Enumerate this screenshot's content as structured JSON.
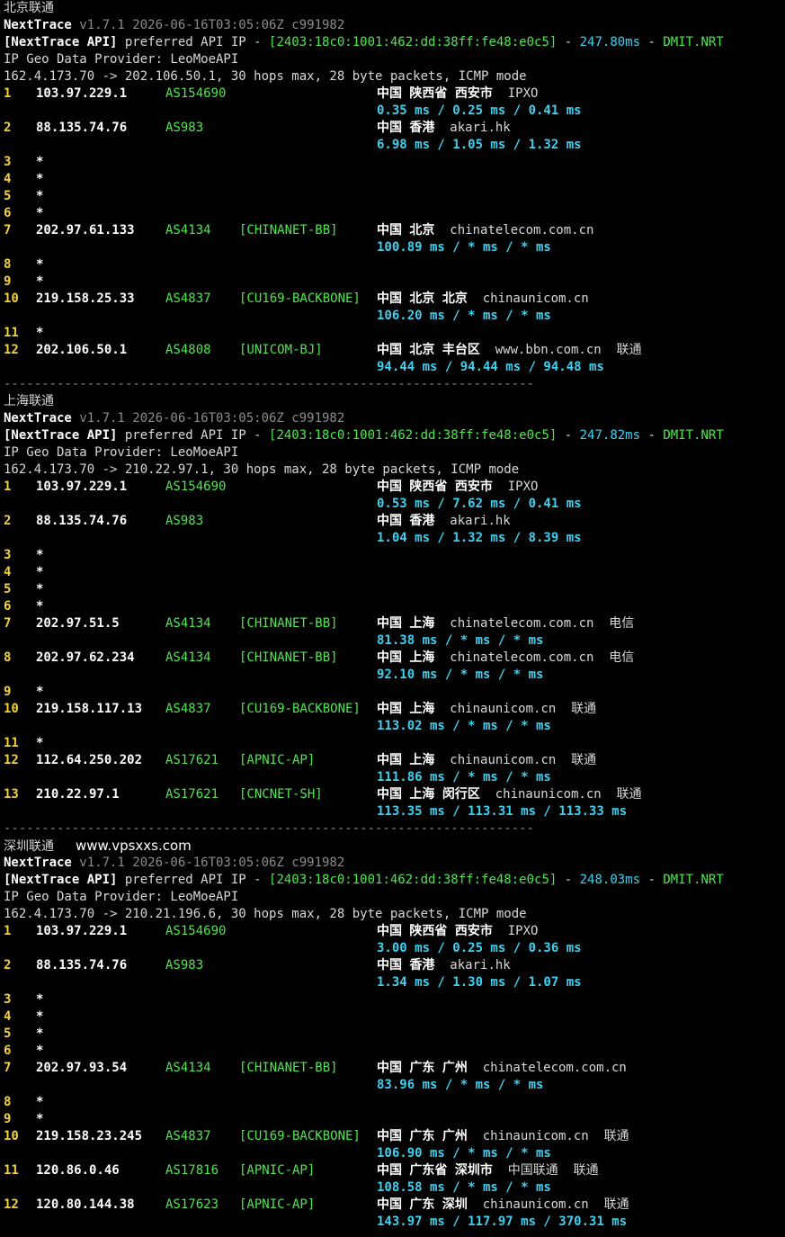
{
  "sections": [
    {
      "title": "北京联通",
      "watermark": "",
      "nexttrace_label": "NextTrace",
      "version": "v1.7.1 2026-06-16T03:05:06Z c991982",
      "api_label": "[NextTrace API]",
      "api_text": "preferred API IP - ",
      "api_ip": "[2403:18c0:1001:462:dd:38ff:fe48:e0c5]",
      "api_dash": " - ",
      "api_latency": "247.80ms",
      "api_dash2": " - ",
      "api_node": "DMIT.NRT",
      "geo_provider": "IP Geo Data Provider: LeoMoeAPI",
      "trace_header": "162.4.173.70 -> 202.106.50.1, 30 hops max, 28 byte packets, ICMP mode",
      "hops": [
        {
          "n": "1",
          "ip": "103.97.229.1",
          "as": "AS154690",
          "tag": "",
          "geo": "中国 陕西省 西安市",
          "host": "IPXO",
          "isp": "",
          "rtt": "0.35 ms / 0.25 ms / 0.41 ms"
        },
        {
          "n": "2",
          "ip": "88.135.74.76",
          "as": "AS983",
          "tag": "",
          "geo": "中国 香港",
          "host": "akari.hk",
          "isp": "",
          "rtt": "6.98 ms / 1.05 ms / 1.32 ms"
        },
        {
          "n": "3",
          "ip": "*"
        },
        {
          "n": "4",
          "ip": "*"
        },
        {
          "n": "5",
          "ip": "*"
        },
        {
          "n": "6",
          "ip": "*"
        },
        {
          "n": "7",
          "ip": "202.97.61.133",
          "as": "AS4134",
          "tag": "[CHINANET-BB]",
          "geo": "中国 北京",
          "host": "chinatelecom.com.cn",
          "isp": "",
          "rtt": "100.89 ms / * ms / * ms"
        },
        {
          "n": "8",
          "ip": "*"
        },
        {
          "n": "9",
          "ip": "*"
        },
        {
          "n": "10",
          "ip": "219.158.25.33",
          "as": "AS4837",
          "tag": "[CU169-BACKBONE]",
          "geo": "中国 北京 北京",
          "host": "chinaunicom.cn",
          "isp": "",
          "rtt": "106.20 ms / * ms / * ms"
        },
        {
          "n": "11",
          "ip": "*"
        },
        {
          "n": "12",
          "ip": "202.106.50.1",
          "as": "AS4808",
          "tag": "[UNICOM-BJ]",
          "geo": "中国 北京 丰台区",
          "host": "www.bbn.com.cn",
          "isp": "联通",
          "rtt": "94.44 ms / 94.44 ms / 94.48 ms"
        }
      ]
    },
    {
      "title": "上海联通",
      "watermark": "",
      "nexttrace_label": "NextTrace",
      "version": "v1.7.1 2026-06-16T03:05:06Z c991982",
      "api_label": "[NextTrace API]",
      "api_text": "preferred API IP - ",
      "api_ip": "[2403:18c0:1001:462:dd:38ff:fe48:e0c5]",
      "api_dash": " - ",
      "api_latency": "247.82ms",
      "api_dash2": " - ",
      "api_node": "DMIT.NRT",
      "geo_provider": "IP Geo Data Provider: LeoMoeAPI",
      "trace_header": "162.4.173.70 -> 210.22.97.1, 30 hops max, 28 byte packets, ICMP mode",
      "hops": [
        {
          "n": "1",
          "ip": "103.97.229.1",
          "as": "AS154690",
          "tag": "",
          "geo": "中国 陕西省 西安市",
          "host": "IPXO",
          "isp": "",
          "rtt": "0.53 ms / 7.62 ms / 0.41 ms"
        },
        {
          "n": "2",
          "ip": "88.135.74.76",
          "as": "AS983",
          "tag": "",
          "geo": "中国 香港",
          "host": "akari.hk",
          "isp": "",
          "rtt": "1.04 ms / 1.32 ms / 8.39 ms"
        },
        {
          "n": "3",
          "ip": "*"
        },
        {
          "n": "4",
          "ip": "*"
        },
        {
          "n": "5",
          "ip": "*"
        },
        {
          "n": "6",
          "ip": "*"
        },
        {
          "n": "7",
          "ip": "202.97.51.5",
          "as": "AS4134",
          "tag": "[CHINANET-BB]",
          "geo": "中国 上海",
          "host": "chinatelecom.com.cn",
          "isp": "电信",
          "rtt": "81.38 ms / * ms / * ms"
        },
        {
          "n": "8",
          "ip": "202.97.62.234",
          "as": "AS4134",
          "tag": "[CHINANET-BB]",
          "geo": "中国 上海",
          "host": "chinatelecom.com.cn",
          "isp": "电信",
          "rtt": "92.10 ms / * ms / * ms"
        },
        {
          "n": "9",
          "ip": "*"
        },
        {
          "n": "10",
          "ip": "219.158.117.13",
          "as": "AS4837",
          "tag": "[CU169-BACKBONE]",
          "geo": "中国 上海",
          "host": "chinaunicom.cn",
          "isp": "联通",
          "rtt": "113.02 ms / * ms / * ms"
        },
        {
          "n": "11",
          "ip": "*"
        },
        {
          "n": "12",
          "ip": "112.64.250.202",
          "as": "AS17621",
          "tag": "[APNIC-AP]",
          "geo": "中国 上海",
          "host": "chinaunicom.cn",
          "isp": "联通",
          "rtt": "111.86 ms / * ms / * ms"
        },
        {
          "n": "13",
          "ip": "210.22.97.1",
          "as": "AS17621",
          "tag": "[CNCNET-SH]",
          "geo": "中国 上海 闵行区",
          "host": "chinaunicom.cn",
          "isp": "联通",
          "rtt": "113.35 ms / 113.31 ms / 113.33 ms"
        }
      ]
    },
    {
      "title": "深圳联通",
      "watermark": "www.vpsxxs.com",
      "nexttrace_label": "NextTrace",
      "version": "v1.7.1 2026-06-16T03:05:06Z c991982",
      "api_label": "[NextTrace API]",
      "api_text": "preferred API IP - ",
      "api_ip": "[2403:18c0:1001:462:dd:38ff:fe48:e0c5]",
      "api_dash": " - ",
      "api_latency": "248.03ms",
      "api_dash2": " - ",
      "api_node": "DMIT.NRT",
      "geo_provider": "IP Geo Data Provider: LeoMoeAPI",
      "trace_header": "162.4.173.70 -> 210.21.196.6, 30 hops max, 28 byte packets, ICMP mode",
      "hops": [
        {
          "n": "1",
          "ip": "103.97.229.1",
          "as": "AS154690",
          "tag": "",
          "geo": "中国 陕西省 西安市",
          "host": "IPXO",
          "isp": "",
          "rtt": "3.00 ms / 0.25 ms / 0.36 ms"
        },
        {
          "n": "2",
          "ip": "88.135.74.76",
          "as": "AS983",
          "tag": "",
          "geo": "中国 香港",
          "host": "akari.hk",
          "isp": "",
          "rtt": "1.34 ms / 1.30 ms / 1.07 ms"
        },
        {
          "n": "3",
          "ip": "*"
        },
        {
          "n": "4",
          "ip": "*"
        },
        {
          "n": "5",
          "ip": "*"
        },
        {
          "n": "6",
          "ip": "*"
        },
        {
          "n": "7",
          "ip": "202.97.93.54",
          "as": "AS4134",
          "tag": "[CHINANET-BB]",
          "geo": "中国 广东 广州",
          "host": "chinatelecom.com.cn",
          "isp": "",
          "rtt": "83.96 ms / * ms / * ms"
        },
        {
          "n": "8",
          "ip": "*"
        },
        {
          "n": "9",
          "ip": "*"
        },
        {
          "n": "10",
          "ip": "219.158.23.245",
          "as": "AS4837",
          "tag": "[CU169-BACKBONE]",
          "geo": "中国 广东 广州",
          "host": "chinaunicom.cn",
          "isp": "联通",
          "rtt": "106.90 ms / * ms / * ms"
        },
        {
          "n": "11",
          "ip": "120.86.0.46",
          "as": "AS17816",
          "tag": "[APNIC-AP]",
          "geo": "中国 广东省 深圳市",
          "host": "中国联通",
          "isp": "联通",
          "rtt": "108.58 ms / * ms / * ms"
        },
        {
          "n": "12",
          "ip": "120.80.144.38",
          "as": "AS17623",
          "tag": "[APNIC-AP]",
          "geo": "中国 广东 深圳",
          "host": "chinaunicom.cn",
          "isp": "联通",
          "rtt": "143.97 ms / 117.97 ms / 370.31 ms"
        }
      ]
    }
  ],
  "separator": "----------------------------------------------------------------------"
}
